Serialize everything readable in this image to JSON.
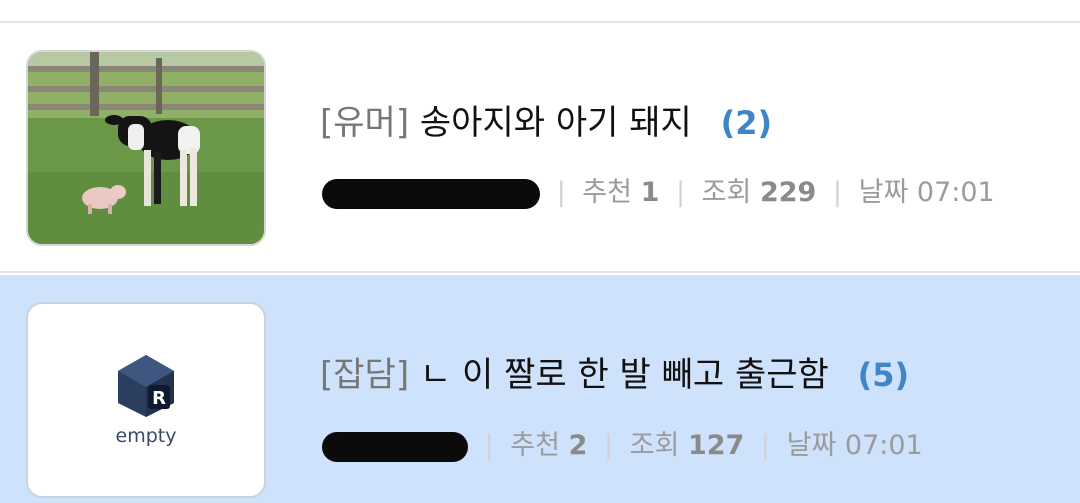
{
  "posts": [
    {
      "category": "[유머]",
      "title": "송아지와 아기 돼지",
      "comment_count": "(2)",
      "author": "",
      "likes_label": "추천",
      "likes": "1",
      "views_label": "조회",
      "views": "229",
      "date_label": "날짜",
      "date": "07:01",
      "thumbnail": "calf-and-piglet-photo"
    },
    {
      "category": "[잡담]",
      "title": "ㄴ 이 짤로 한 발 빼고 출근함",
      "comment_count": "(5)",
      "author": "",
      "likes_label": "추천",
      "likes": "2",
      "views_label": "조회",
      "views": "127",
      "date_label": "날짜",
      "date": "07:01",
      "thumbnail_text": "empty"
    }
  ],
  "colors": {
    "highlight_row": "#cfe2fb",
    "comment_count": "#3f86c8"
  }
}
